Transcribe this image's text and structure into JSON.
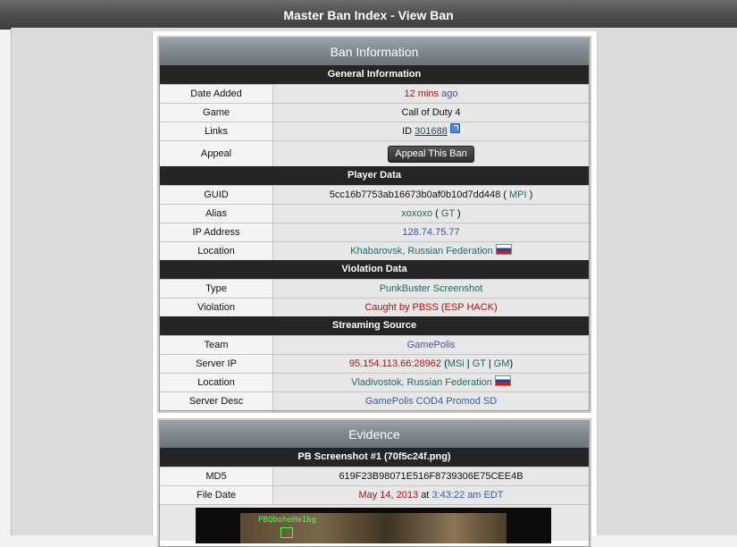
{
  "page_title": "Master Ban Index - View Ban",
  "ban_panel": {
    "heading": "Ban Information",
    "general": {
      "heading": "General Information",
      "date_added_label": "Date Added",
      "date_added_value": "12 mins",
      "date_added_suffix": "ago",
      "game_label": "Game",
      "game_value": "Call of Duty 4",
      "links_label": "Links",
      "links_prefix": "ID",
      "links_id": "301688",
      "appeal_label": "Appeal",
      "appeal_button": "Appeal This Ban"
    },
    "player": {
      "heading": "Player Data",
      "guid_label": "GUID",
      "guid_value": "5cc16b7753ab16673b0af0b10d7dd448",
      "guid_link": "MPI",
      "alias_label": "Alias",
      "alias_value": "xoxoxo",
      "alias_link": "GT",
      "ip_label": "IP Address",
      "ip_value": "128.74.75.77",
      "location_label": "Location",
      "location_value": "Khabarovsk, Russian Federation"
    },
    "violation": {
      "heading": "Violation Data",
      "type_label": "Type",
      "type_value": "PunkBuster Screenshot",
      "violation_label": "Violation",
      "violation_value": "Caught by PBSS (ESP HACK)"
    },
    "streaming": {
      "heading": "Streaming Source",
      "team_label": "Team",
      "team_value": "GamePolis",
      "server_ip_label": "Server IP",
      "server_ip_value": "95.154.113.66:28962",
      "server_links": [
        "MSi",
        "GT",
        "GM"
      ],
      "location_label": "Location",
      "location_value": "Vladivostok, Russian Federation",
      "desc_label": "Server Desc",
      "desc_value": "GamePolis COD4 Promod SD"
    }
  },
  "evidence_panel": {
    "heading": "Evidence",
    "screenshot_heading": "PB Screenshot #1 (70f5c24f.png)",
    "md5_label": "MD5",
    "md5_value": "619F23B98071E516F8739306E75CEE4B",
    "file_date_label": "File Date",
    "file_date_value": "May 14, 2013",
    "file_date_at": "at",
    "file_time_value": "3:43:22 am EDT",
    "screenshot_overlay_text": "PBQboheHe1bg"
  },
  "colors": {
    "section_bar": "#252525",
    "red_text": "#b10f0f",
    "blue_text": "#3a58a0",
    "teal_text": "#1f6a66"
  }
}
